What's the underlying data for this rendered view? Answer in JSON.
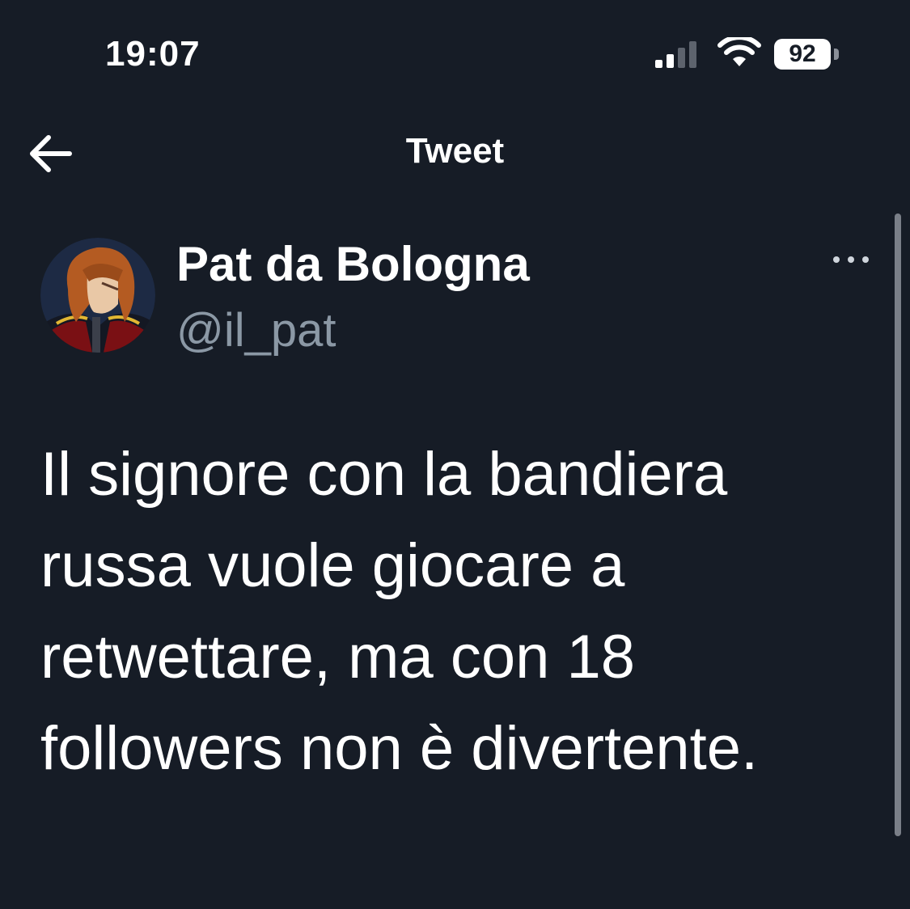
{
  "status_bar": {
    "time": "19:07",
    "battery_level": "92",
    "icons": [
      "cellular-signal-icon",
      "wifi-icon",
      "battery-icon"
    ]
  },
  "nav": {
    "title": "Tweet",
    "back_icon": "arrow-left-icon"
  },
  "tweet": {
    "author": {
      "display_name": "Pat da Bologna",
      "handle": "@il_pat"
    },
    "more_icon": "ellipsis-icon",
    "text": "Il signore con la bandiera russa vuole giocare a retwettare, ma con 18 followers non è divertente."
  },
  "colors": {
    "background": "#161c26",
    "primary_text": "#ffffff",
    "secondary_text": "#8b98a5"
  }
}
